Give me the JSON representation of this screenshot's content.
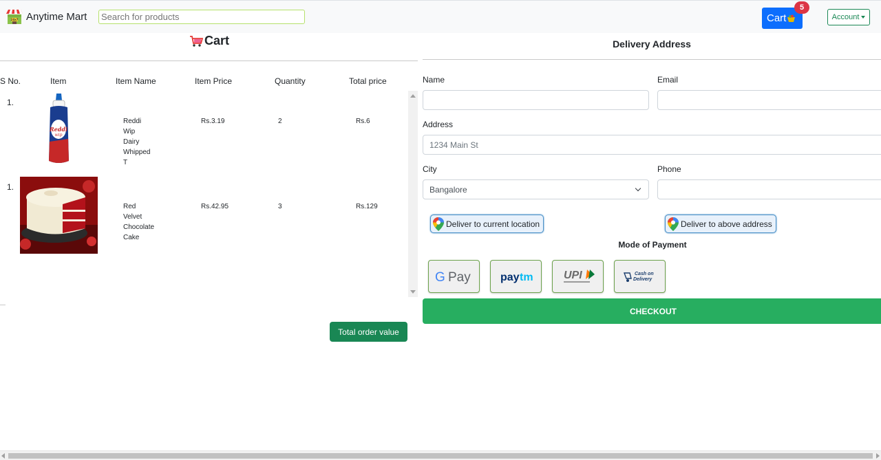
{
  "navbar": {
    "brand": "Anytime Mart",
    "search_placeholder": "Search for products",
    "cart_label": "Cart",
    "cart_count": "5",
    "account_label": "Account"
  },
  "cart": {
    "title": "Cart",
    "columns": [
      "S No.",
      "Item",
      "Item Name",
      "Item Price",
      "Quantity",
      "Total price"
    ],
    "rows": [
      {
        "sno": "1.",
        "name_lines": [
          "Reddi",
          "Wip",
          "Dairy",
          "Whipped",
          "T"
        ],
        "price": "Rs.3.19",
        "quantity": "2",
        "total": "Rs.6",
        "image": "whipped-cream-can"
      },
      {
        "sno": "1.",
        "name_lines": [
          "Red",
          "Velvet",
          "Chocolate",
          "Cake"
        ],
        "price": "Rs.42.95",
        "quantity": "3",
        "total": "Rs.129",
        "image": "red-velvet-cake"
      }
    ],
    "total_button": "Total order value"
  },
  "delivery": {
    "title": "Delivery Address",
    "name_label": "Name",
    "email_label": "Email",
    "address_label": "Address",
    "address_placeholder": "1234 Main St",
    "city_label": "City",
    "city_value": "Bangalore",
    "phone_label": "Phone",
    "current_location_button": "Deliver to current location",
    "above_address_button": "Deliver to above address",
    "payment_title": "Mode of Payment",
    "payment_options": [
      {
        "name": "gpay",
        "label": "G Pay"
      },
      {
        "name": "paytm",
        "label": "paytm"
      },
      {
        "name": "upi",
        "label": "UPI"
      },
      {
        "name": "cod",
        "label": "Cash on Delivery"
      }
    ],
    "checkout_label": "CHECKOUT"
  },
  "colors": {
    "primary": "#0d6efd",
    "success": "#198754",
    "checkout": "#27ae60",
    "badge": "#dc3545"
  }
}
